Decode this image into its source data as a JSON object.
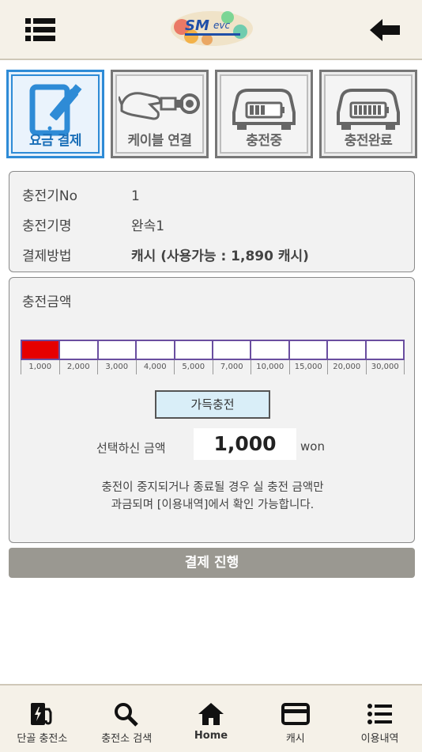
{
  "header": {
    "logo_text": "SM evc"
  },
  "steps": [
    {
      "label": "요금 결제",
      "active": true
    },
    {
      "label": "케이블 연결",
      "active": false
    },
    {
      "label": "충전중",
      "active": false
    },
    {
      "label": "충전완료",
      "active": false
    }
  ],
  "info": {
    "charger_no_label": "충전기No",
    "charger_no": "1",
    "charger_name_label": "충전기명",
    "charger_name": "완속1",
    "pay_method_label": "결제방법",
    "pay_method": "캐시 (사용가능 : 1,890 캐시)"
  },
  "amount": {
    "title": "충전금액",
    "options": [
      "1,000",
      "2,000",
      "3,000",
      "4,000",
      "5,000",
      "7,000",
      "10,000",
      "15,000",
      "20,000",
      "30,000"
    ],
    "selected_index": 0,
    "full_button": "가득충전",
    "selected_label": "선택하신 금액",
    "selected_value": "1,000",
    "unit": "won",
    "notice_line1": "충전이 중지되거나 종료될 경우 실 충전 금액만",
    "notice_line2": "과금되며 [이용내역]에서 확인 가능합니다."
  },
  "pay_button": "결제 진행",
  "nav": [
    {
      "label": "단골 충전소",
      "icon": "ev-station-icon"
    },
    {
      "label": "충전소 검색",
      "icon": "search-icon"
    },
    {
      "label": "Home",
      "icon": "home-icon"
    },
    {
      "label": "캐시",
      "icon": "card-icon"
    },
    {
      "label": "이용내역",
      "icon": "list-icon"
    }
  ],
  "colors": {
    "accent": "#2e8bd6",
    "selected": "#e60000",
    "bar_border": "#6a4ea0",
    "pay_button": "#9a9891"
  }
}
